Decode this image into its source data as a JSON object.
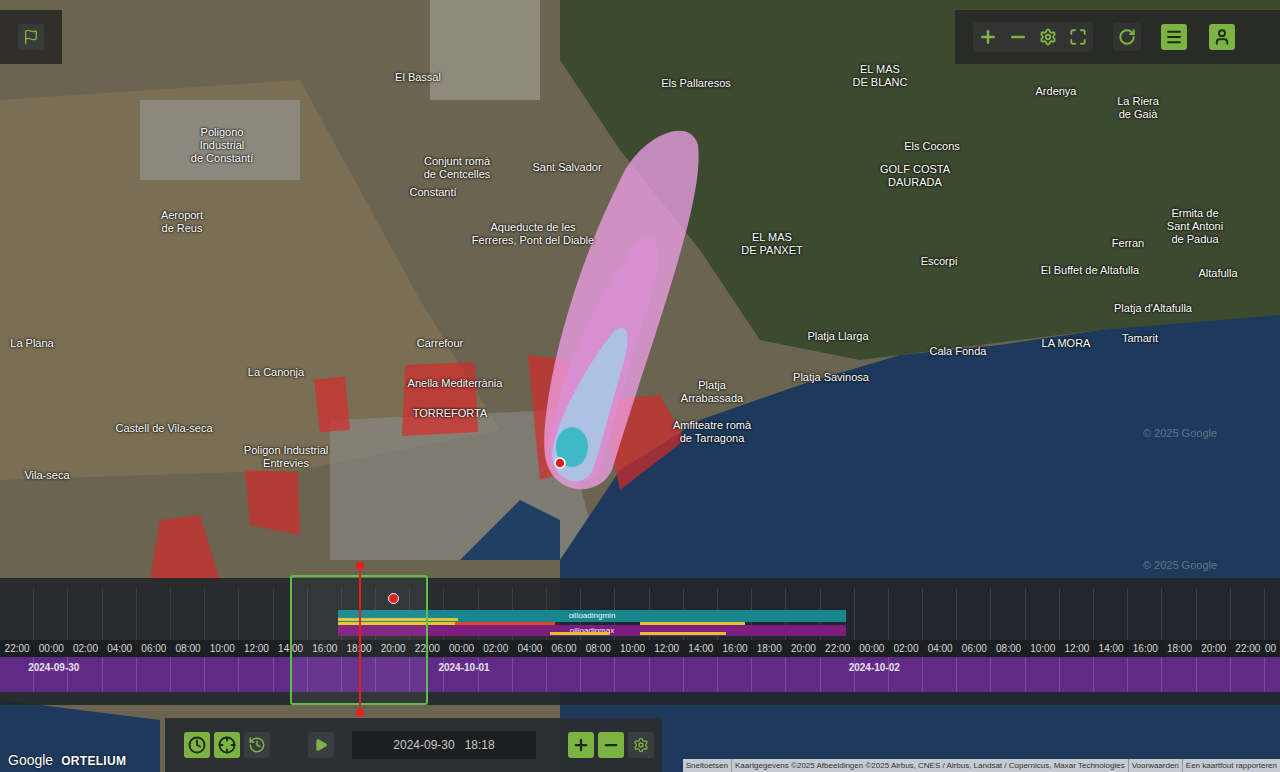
{
  "map": {
    "labels": [
      "El Bassal",
      "Els Pallaresos",
      "EL MAS\nDE BLANC",
      "Ardenya",
      "La Riera\nde Gaià",
      "Poligono\nIndustrial\nde Constantí",
      "Conjunt romà\nde Centcelles",
      "Sant Salvador",
      "Els Cocons",
      "GOLF COSTA\nDAURADA",
      "Constantí",
      "Aeroport\nde Reus",
      "Aqueducte de les\nFerreres, Pont del Diable",
      "EL MAS\nDE PANXET",
      "Escorpi",
      "Ermita de\nSant Antoni\nde Padua",
      "Ferran",
      "El Buffet de Altafulla",
      "Altafulla",
      "Platja d'Altafulla",
      "Tamarit",
      "La Plana",
      "Carrefour",
      "Platja Llarga",
      "Platja Savinosa",
      "Cala Fonda",
      "LA MORA",
      "La Canonja",
      "Anella Mediterrània",
      "TORREFORTA",
      "Castell de Vila-seca",
      "Poligon Industrial\nEntrevies",
      "Vila-seca",
      "Amfiteatre romà\nde Tarragona",
      "Platja\nArrabassada"
    ],
    "watermarks": [
      "© 2025 Google",
      "© 2025 Google"
    ]
  },
  "timeline": {
    "ticks": [
      "22:00",
      "00:00",
      "02:00",
      "04:00",
      "06:00",
      "08:00",
      "10:00",
      "12:00",
      "14:00",
      "16:00",
      "18:00",
      "20:00",
      "22:00",
      "00:00",
      "02:00",
      "04:00",
      "06:00",
      "08:00",
      "10:00",
      "12:00",
      "14:00",
      "16:00",
      "18:00",
      "20:00",
      "22:00",
      "00:00",
      "02:00",
      "04:00",
      "06:00",
      "08:00",
      "10:00",
      "12:00",
      "14:00",
      "16:00",
      "18:00",
      "20:00",
      "22:00",
      "00"
    ],
    "dates": [
      "2024-09-30",
      "2024-10-01",
      "2024-10-02"
    ],
    "events": [
      {
        "label": "oilloadingmin",
        "color": "#17868f"
      },
      {
        "label": "oilloadinmax",
        "color": "#7d1d7e"
      }
    ]
  },
  "controls": {
    "datetime": "2024-09-30   18:18"
  },
  "branding": {
    "google": "Google",
    "app": "ORTELIUM"
  },
  "attribution": [
    "Sneltoetsen",
    "Kaartgegevens ©2025 Afbeeldingen ©2025 Airbus, CNES / Airbus, Landsat / Copernicus, Maxar Technologies",
    "Voorwaarden",
    "Een kaartfout rapporteren"
  ]
}
